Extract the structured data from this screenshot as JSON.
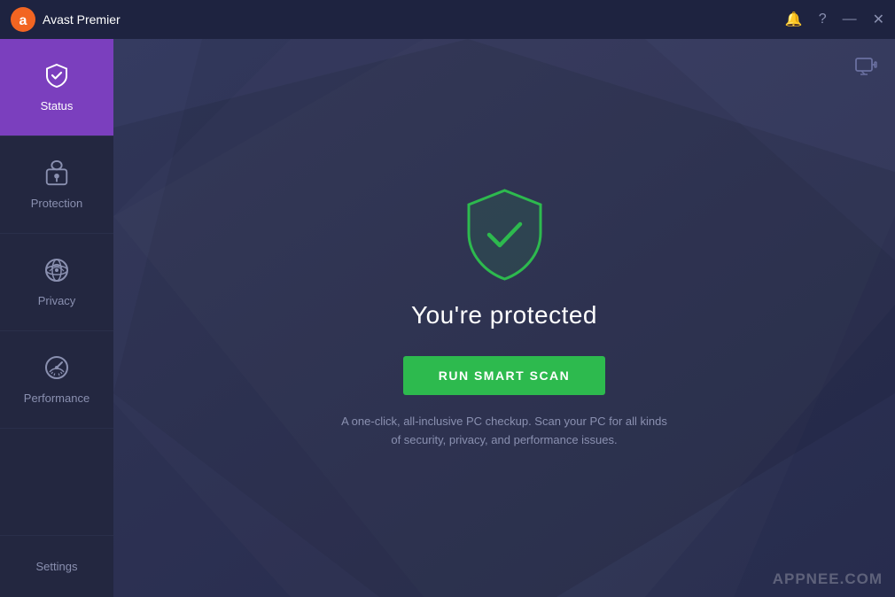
{
  "app": {
    "title": "Avast Premier"
  },
  "titlebar": {
    "title": "Avast Premier",
    "controls": {
      "bell": "🔔",
      "help": "?",
      "minimize": "—",
      "close": "✕"
    }
  },
  "sidebar": {
    "items": [
      {
        "id": "status",
        "label": "Status",
        "active": true
      },
      {
        "id": "protection",
        "label": "Protection",
        "active": false
      },
      {
        "id": "privacy",
        "label": "Privacy",
        "active": false
      },
      {
        "id": "performance",
        "label": "Performance",
        "active": false
      }
    ],
    "settings_label": "Settings"
  },
  "main": {
    "protected_text": "You're protected",
    "scan_button_label": "RUN SMART SCAN",
    "description": "A one-click, all-inclusive PC checkup. Scan your PC for all kinds of security, privacy, and performance issues.",
    "watermark": "APPNEE.COM"
  }
}
